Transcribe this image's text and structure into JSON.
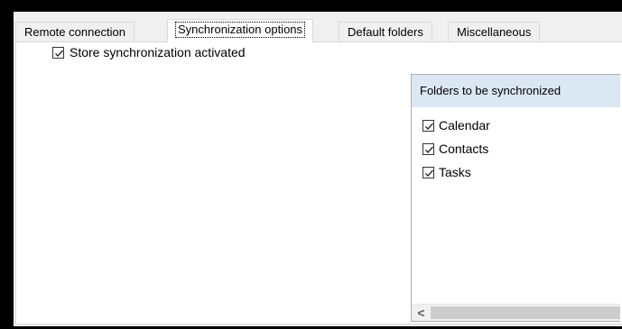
{
  "tabs": [
    {
      "label": "Remote connection"
    },
    {
      "label": "Synchronization options"
    },
    {
      "label": "Default folders"
    },
    {
      "label": "Miscellaneous"
    }
  ],
  "options": {
    "store_sync_label": "Store synchronization activated",
    "store_sync_checked": true
  },
  "folders": {
    "header": "Folders to be synchronized",
    "items": [
      {
        "label": "Calendar",
        "checked": true
      },
      {
        "label": "Contacts",
        "checked": true
      },
      {
        "label": "Tasks",
        "checked": true
      }
    ],
    "scroll_left_glyph": "<"
  },
  "icons": {
    "check": "checkmark-icon",
    "scroll_left": "chevron-left-icon"
  }
}
